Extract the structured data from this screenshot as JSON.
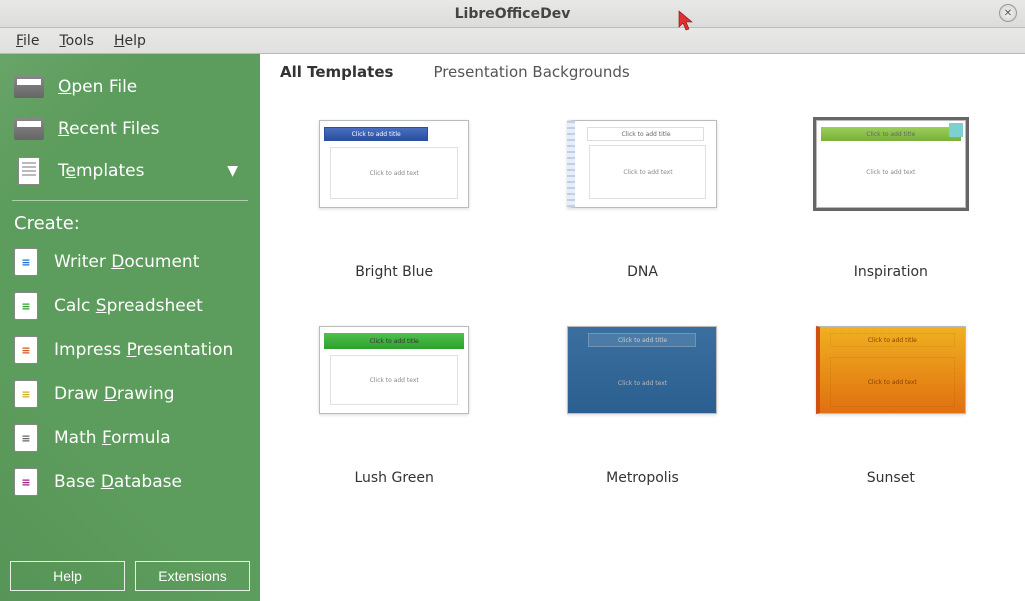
{
  "window": {
    "title": "LibreOfficeDev"
  },
  "menu": {
    "items": [
      "File",
      "Tools",
      "Help"
    ]
  },
  "sidebar": {
    "open_file": "Open File",
    "recent_files": "Recent Files",
    "templates": "Templates",
    "create_heading": "Create:",
    "create": [
      {
        "label": "Writer Document",
        "u": 7,
        "cls": "doc-writer"
      },
      {
        "label": "Calc Spreadsheet",
        "u": 5,
        "cls": "doc-calc"
      },
      {
        "label": "Impress Presentation",
        "u": 8,
        "cls": "doc-impress"
      },
      {
        "label": "Draw Drawing",
        "u": 5,
        "cls": "doc-draw"
      },
      {
        "label": "Math Formula",
        "u": 5,
        "cls": "doc-math"
      },
      {
        "label": "Base Database",
        "u": 5,
        "cls": "doc-base"
      }
    ],
    "help_btn": "Help",
    "ext_btn": "Extensions"
  },
  "tabs": [
    "All Templates",
    "Presentation Backgrounds"
  ],
  "templates": [
    {
      "name": "Bright Blue",
      "cls": "t-brightblue",
      "selected": false
    },
    {
      "name": "DNA",
      "cls": "t-dna",
      "selected": false
    },
    {
      "name": "Inspiration",
      "cls": "t-inspiration",
      "selected": true
    },
    {
      "name": "Lush Green",
      "cls": "t-lushgreen",
      "selected": false
    },
    {
      "name": "Metropolis",
      "cls": "t-metropolis",
      "selected": false
    },
    {
      "name": "Sunset",
      "cls": "t-sunset",
      "selected": false
    }
  ],
  "thumb": {
    "title_placeholder": "Click to add title",
    "body_placeholder": "Click to add text"
  }
}
